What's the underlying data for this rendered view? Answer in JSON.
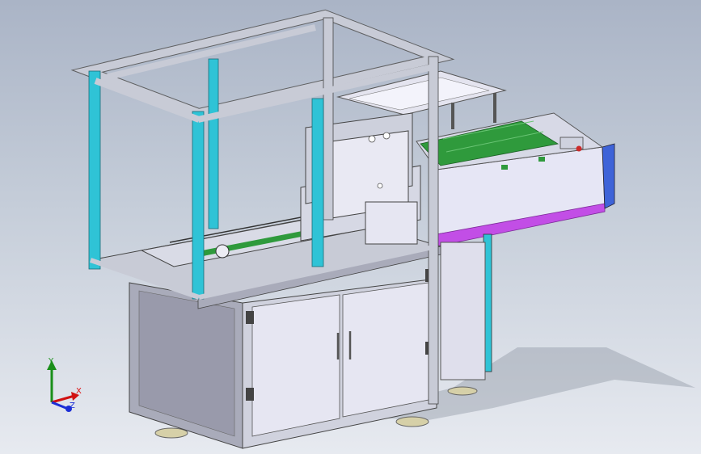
{
  "viewport": {
    "background_top": "#aab4c6",
    "background_bottom": "#e7eaf0"
  },
  "model": {
    "frame_color": "#c8cbd6",
    "panel_color": "#e6e6f2",
    "cyan_accent": "#2fc3d6",
    "magenta_accent": "#c24ee6",
    "green_accent": "#2f9a3c"
  },
  "triad": {
    "y_label": "Y",
    "x_label": "X",
    "z_label": "Z",
    "y_color": "#1a8f1a",
    "x_color": "#d11111",
    "z_color": "#1b2ed6"
  }
}
